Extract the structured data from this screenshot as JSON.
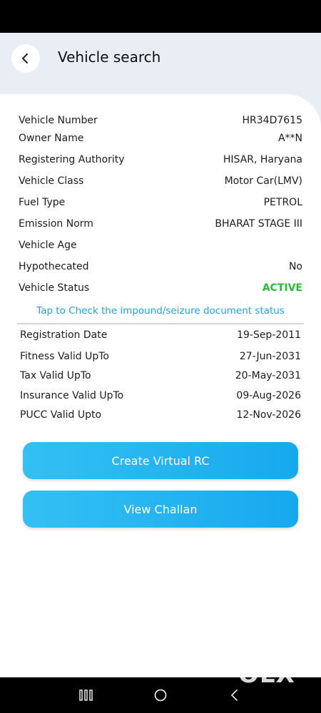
{
  "header": {
    "title": "Vehicle search"
  },
  "details": [
    {
      "label": "Vehicle Number",
      "value": "HR34D7615"
    },
    {
      "label": "Owner Name",
      "value": "A**N"
    },
    {
      "label": "Registering Authority",
      "value": "HISAR, Haryana"
    },
    {
      "label": "Vehicle Class",
      "value": "Motor Car(LMV)"
    },
    {
      "label": "Fuel Type",
      "value": "PETROL"
    },
    {
      "label": "Emission Norm",
      "value": "BHARAT STAGE III"
    },
    {
      "label": "Vehicle Age",
      "value": ""
    },
    {
      "label": "Hypothecated",
      "value": "No"
    },
    {
      "label": "Vehicle Status",
      "value": "ACTIVE"
    }
  ],
  "impound_link": "Tap to Check the impound/seizure document status",
  "validity": [
    {
      "label": "Registration Date",
      "value": "19-Sep-2011"
    },
    {
      "label": "Fitness Valid UpTo",
      "value": "27-Jun-2031"
    },
    {
      "label": "Tax Valid UpTo",
      "value": "20-May-2031"
    },
    {
      "label": "Insurance Valid UpTo",
      "value": "09-Aug-2026"
    },
    {
      "label": "PUCC Valid Upto",
      "value": "12-Nov-2026"
    }
  ],
  "buttons": {
    "virtual_rc": "Create Virtual RC",
    "challan": "View Challan"
  },
  "watermark": "OLX",
  "colors": {
    "accent": "#1aa6e4",
    "active": "#2bbb3a"
  }
}
